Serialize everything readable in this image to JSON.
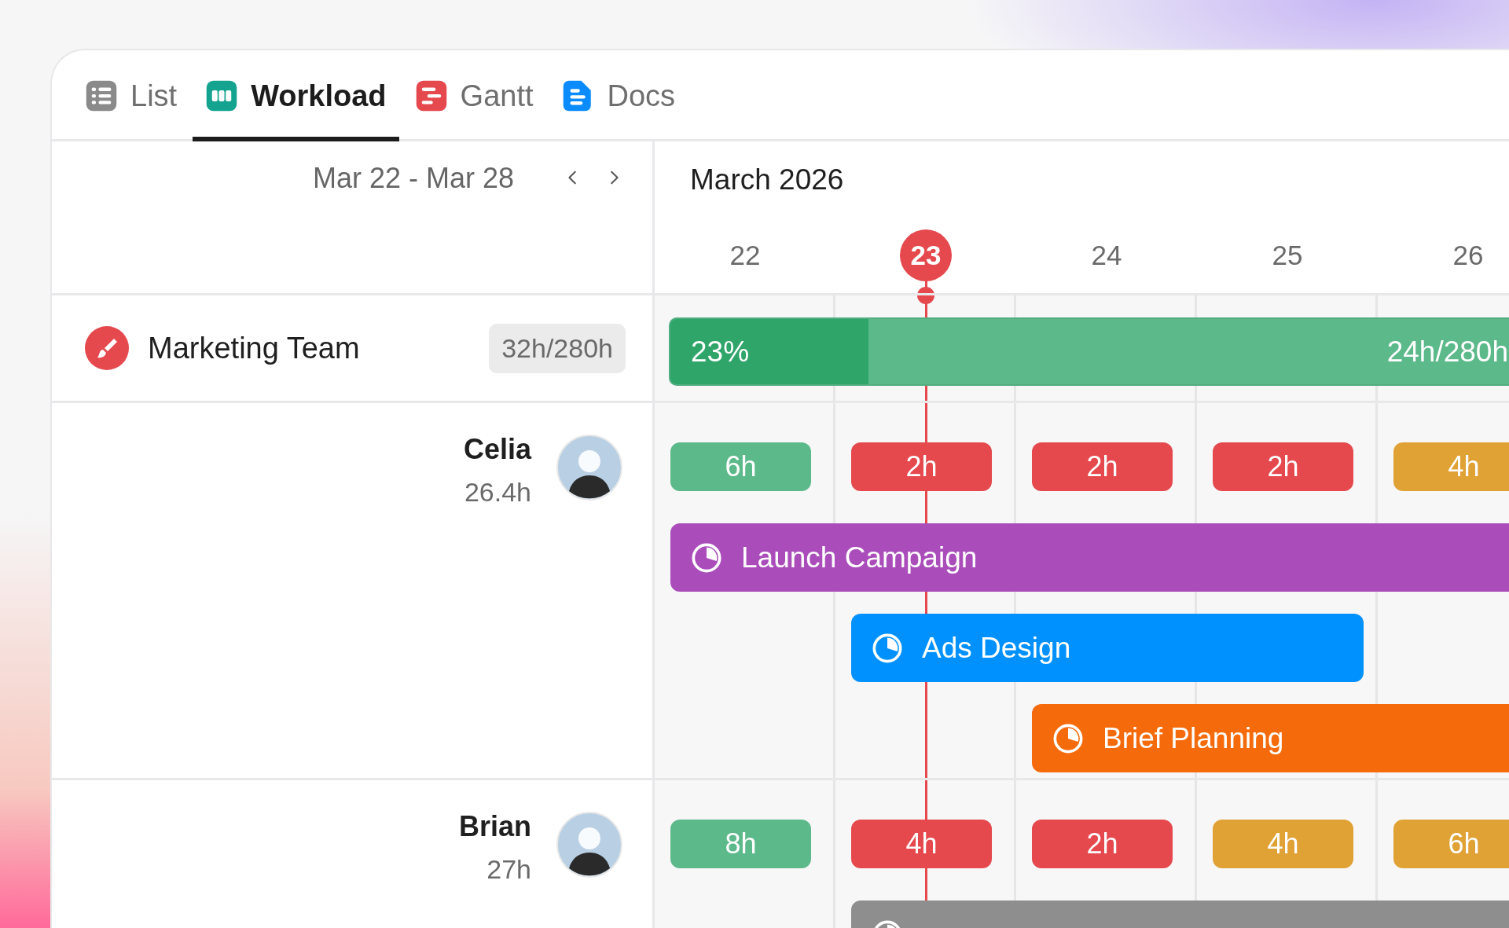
{
  "tabs": [
    {
      "label": "List",
      "kind": "list",
      "selected": false
    },
    {
      "label": "Workload",
      "kind": "workload",
      "selected": true
    },
    {
      "label": "Gantt",
      "kind": "gantt",
      "selected": false
    },
    {
      "label": "Docs",
      "kind": "docs",
      "selected": false
    }
  ],
  "date_range": "Mar 22 - Mar 28",
  "month": "March 2026",
  "days": [
    {
      "label": "22",
      "today": false
    },
    {
      "label": "23",
      "today": true
    },
    {
      "label": "24",
      "today": false
    },
    {
      "label": "25",
      "today": false
    },
    {
      "label": "26",
      "today": false
    }
  ],
  "team": {
    "name": "Marketing Team",
    "hours": "32h/280h",
    "percent": "23%",
    "level": 0.23,
    "capacity": "24h/280h"
  },
  "people": [
    {
      "name": "Celia",
      "hours": "26.4h",
      "days": [
        {
          "hours": "6h",
          "color": "#5cb98a"
        },
        {
          "hours": "2h",
          "color": "#e5484d"
        },
        {
          "hours": "2h",
          "color": "#e5484d"
        },
        {
          "hours": "2h",
          "color": "#e5484d"
        },
        {
          "hours": "4h",
          "color": "#e0a235"
        }
      ],
      "tasks": [
        {
          "label": "Launch Campaign",
          "color": "#aa4dbb",
          "on_days": [
            true,
            true,
            true,
            true,
            true
          ]
        },
        {
          "label": "Ads Design",
          "color": "#0091ff",
          "on_days": [
            false,
            true,
            true,
            true,
            false
          ]
        },
        {
          "label": "Brief Planning",
          "color": "#f56a0a",
          "on_days": [
            false,
            false,
            true,
            true,
            true
          ]
        }
      ]
    },
    {
      "name": "Brian",
      "hours": "27h",
      "days": [
        {
          "hours": "8h",
          "color": "#5cb98a"
        },
        {
          "hours": "4h",
          "color": "#e5484d"
        },
        {
          "hours": "2h",
          "color": "#e5484d"
        },
        {
          "hours": "4h",
          "color": "#e0a235"
        },
        {
          "hours": "6h",
          "color": "#e0a235"
        }
      ],
      "tasks": [
        {
          "color": "#8e8e8e",
          "on_days": [
            false,
            true,
            true,
            true,
            true
          ]
        }
      ]
    }
  ]
}
